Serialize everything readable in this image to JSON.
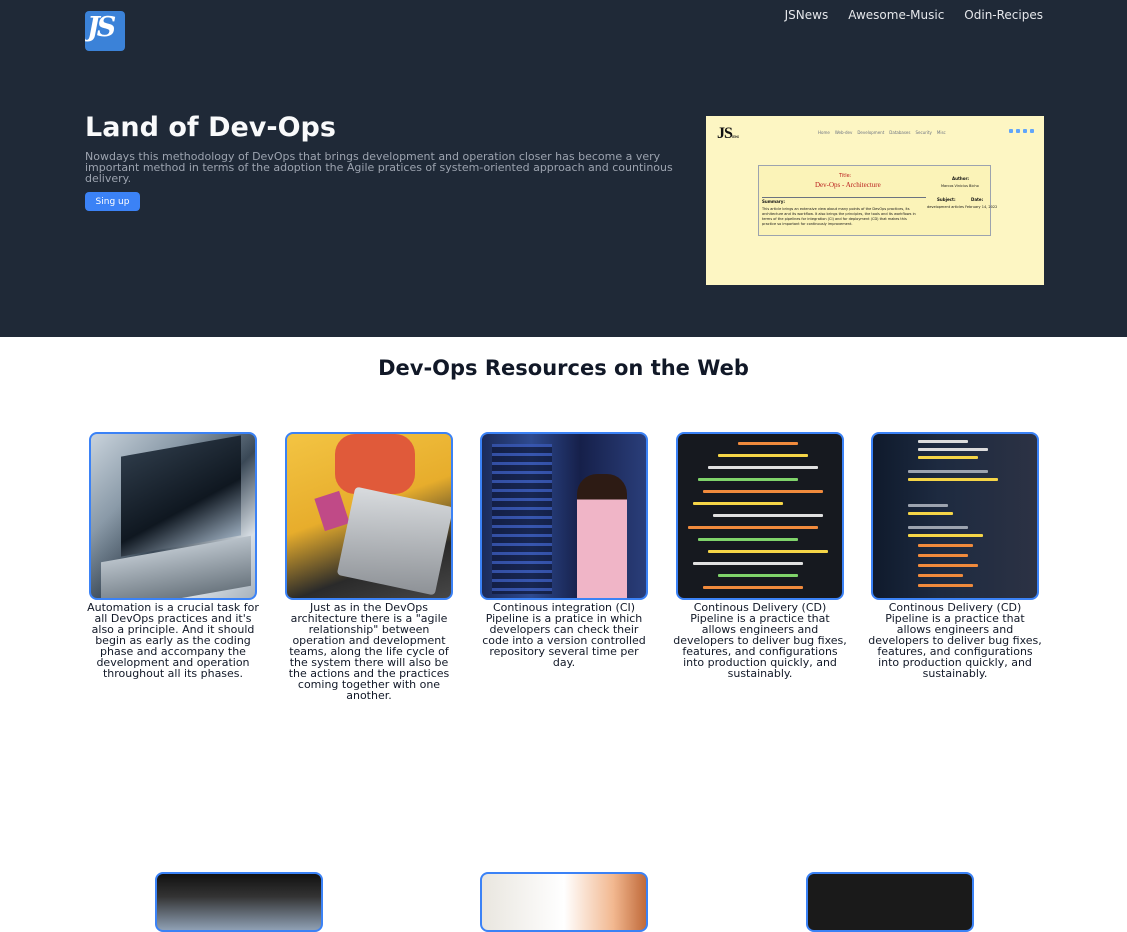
{
  "brand": {
    "logo_text": "JS"
  },
  "nav": {
    "items": [
      "JSNews",
      "Awesome-Music",
      "Odin-Recipes"
    ]
  },
  "hero": {
    "title": "Land of Dev-Ops",
    "description": "Nowdays this methodology of DevOps that brings development and operation closer has become a very important method in terms of the adoption the Agile pratices of system-oriented approach and countinous delivery.",
    "cta_label": "Sing up"
  },
  "preview": {
    "logo": "JS",
    "logo_sub": "news",
    "nav": [
      "Home",
      "Web-dev",
      "Development",
      "Databases",
      "Security",
      "Misc"
    ],
    "kicker": "Title:",
    "title": "Dev-Ops - Architecture",
    "summary_label": "Summary:",
    "summary": "This article brings an extensive view about many points of the DevOps practices, its architecture and its workflow. It also brings the principles, the tools and its workflows in terms of the pipelines for integration (CI) and for deployment (CD) that makes this practice so important for continously improvement.",
    "author_label": "Author:",
    "author": "Marcos Vinicius Bicho",
    "subject_label": "Subject:",
    "date_label": "Date:",
    "subject_value": "development articles  February 14, 2022"
  },
  "resources": {
    "title": "Dev-Ops Resources on the Web",
    "cards": [
      {
        "text": "Automation is a crucial task for all DevOps practices and it's also a principle. And it should begin as early as the coding phase and accompany the development and operation throughout all its phases."
      },
      {
        "text": "Just as in the DevOps architecture there is a \"agile relationship\" between operation and development teams, along the life cycle of the system there will also be the actions and the practices coming together with one another."
      },
      {
        "text": "Continous integration (CI) Pipeline is a pratice in which developers can check their code into a version controlled repository several time per day."
      },
      {
        "text": "Continous Delivery (CD) Pipeline is a practice that allows engineers and developers to deliver bug fixes, features, and configurations into production quickly, and sustainably."
      },
      {
        "text": "Continous Delivery (CD) Pipeline is a practice that allows engineers and developers to deliver bug fixes, features, and configurations into production quickly, and sustainably."
      }
    ]
  },
  "colors": {
    "hero_bg": "#1f2937",
    "accent": "#3b82f6"
  }
}
